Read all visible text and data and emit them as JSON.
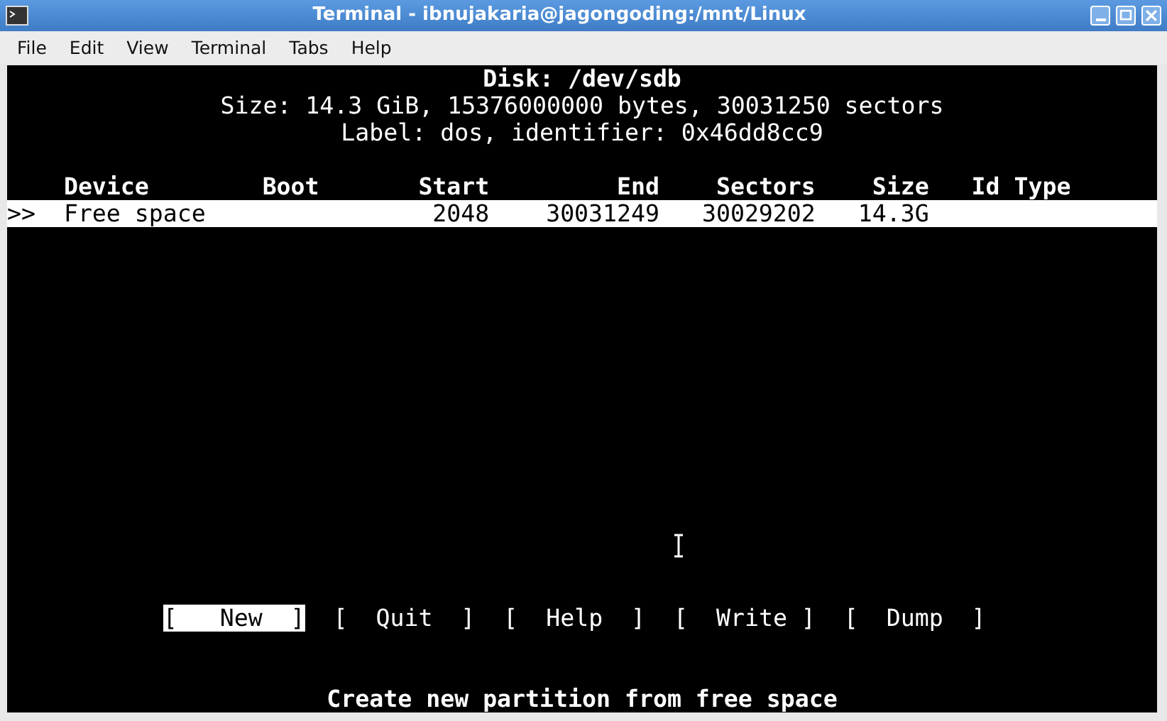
{
  "window": {
    "title": "Terminal - ibnujakaria@jagongoding:/mnt/Linux"
  },
  "menu": [
    "File",
    "Edit",
    "View",
    "Terminal",
    "Tabs",
    "Help"
  ],
  "disk": {
    "title": "Disk: /dev/sdb",
    "size_line": "Size: 14.3 GiB, 15376000000 bytes, 30031250 sectors",
    "label_line": "Label: dos, identifier: 0x46dd8cc9"
  },
  "table": {
    "columns": [
      "Device",
      "Boot",
      "Start",
      "End",
      "Sectors",
      "Size",
      "Id",
      "Type"
    ],
    "rows": [
      {
        "marker": ">>",
        "selected": true,
        "device": "Free space",
        "start": "2048",
        "end": "30031249",
        "sectors": "30029202",
        "size": "14.3G"
      }
    ]
  },
  "actions": [
    {
      "label": "[   New  ]",
      "selected": true
    },
    {
      "label": "[  Quit  ]",
      "selected": false
    },
    {
      "label": "[  Help  ]",
      "selected": false
    },
    {
      "label": "[  Write ]",
      "selected": false
    },
    {
      "label": "[  Dump  ]",
      "selected": false
    }
  ],
  "status": "Create new partition from free space"
}
